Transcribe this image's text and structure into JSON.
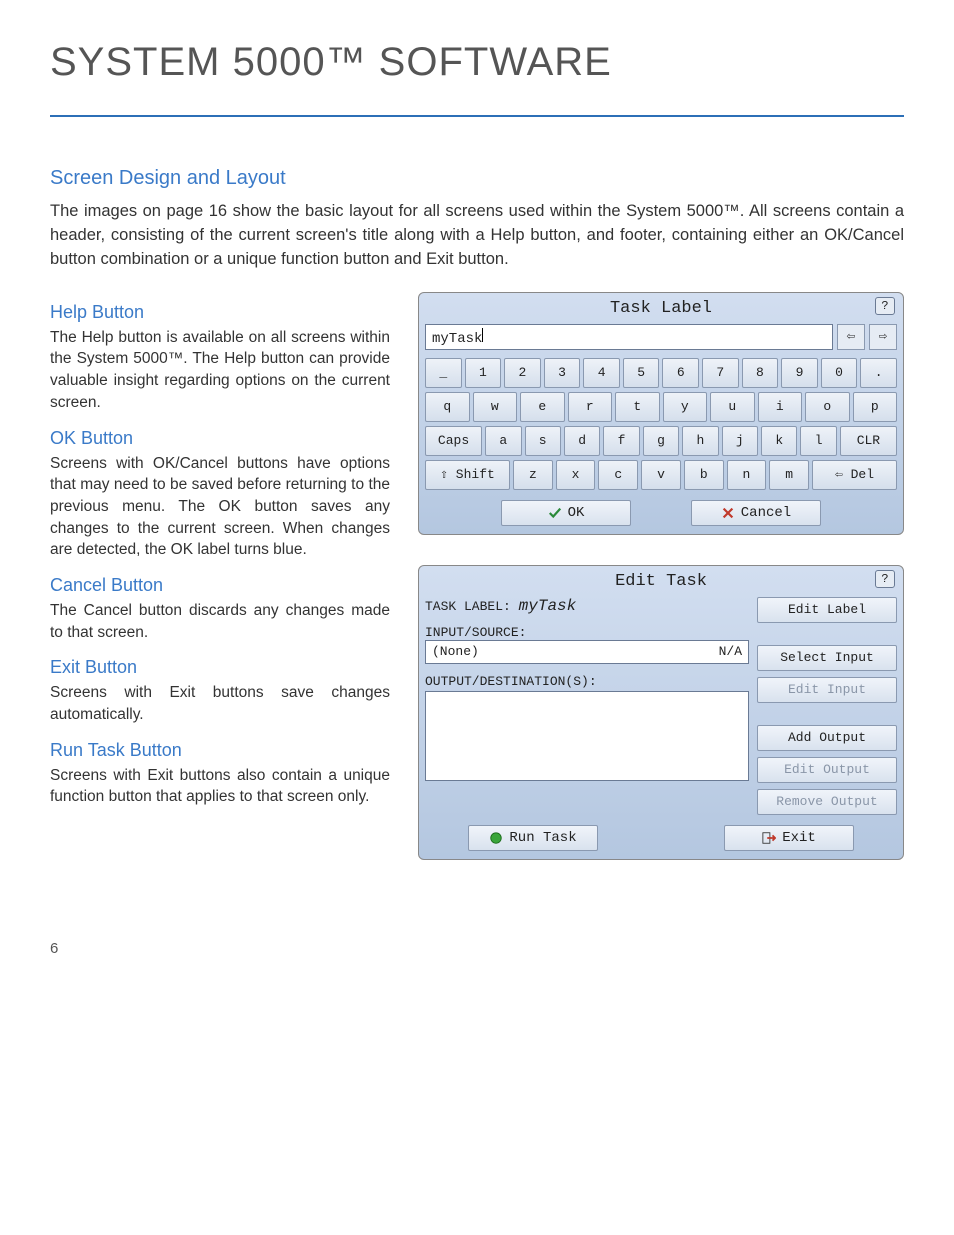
{
  "page": {
    "title": "SYSTEM 5000™ SOFTWARE",
    "page_number": "6"
  },
  "section": {
    "heading": "Screen Design and Layout",
    "intro": "The images on page 16 show the basic layout for all screens used within the System 5000™. All screens contain a header, consisting of the current screen's title along with a Help button, and footer, containing either an OK/Cancel button combination or a unique function button and Exit button."
  },
  "subsections": {
    "help": {
      "heading": "Help Button",
      "body": "The Help button is available on all screens within the System 5000™. The Help button can provide valuable insight regarding options on the current screen."
    },
    "ok": {
      "heading": "OK Button",
      "body": "Screens with OK/Cancel buttons have options that may need to be saved before returning to the previous menu. The OK button saves any changes to the current screen. When changes are detected, the OK label turns blue."
    },
    "cancel": {
      "heading": "Cancel Button",
      "body": "The Cancel button discards any changes made to that screen."
    },
    "exit": {
      "heading": "Exit Button",
      "body": "Screens with Exit buttons save changes automatically."
    },
    "runtask": {
      "heading": "Run Task Button",
      "body": "Screens with Exit buttons also contain a unique function button that applies to that screen only."
    }
  },
  "task_label_panel": {
    "title": "Task Label",
    "input_value": "myTask",
    "keyboard": {
      "row1": [
        "_",
        "1",
        "2",
        "3",
        "4",
        "5",
        "6",
        "7",
        "8",
        "9",
        "0",
        "."
      ],
      "row2": [
        "q",
        "w",
        "e",
        "r",
        "t",
        "y",
        "u",
        "i",
        "o",
        "p"
      ],
      "row3_caps": "Caps",
      "row3": [
        "a",
        "s",
        "d",
        "f",
        "g",
        "h",
        "j",
        "k",
        "l"
      ],
      "row3_clr": "CLR",
      "row4_shift": "Shift",
      "row4": [
        "z",
        "x",
        "c",
        "v",
        "b",
        "n",
        "m"
      ],
      "row4_del": "Del"
    },
    "ok_label": "OK",
    "cancel_label": "Cancel"
  },
  "edit_task_panel": {
    "title": "Edit Task",
    "task_label_caption": "TASK LABEL:",
    "task_label_value": "myTask",
    "input_source_caption": "INPUT/SOURCE:",
    "input_source_value": "(None)",
    "input_source_right": "N/A",
    "output_caption": "OUTPUT/DESTINATION(S):",
    "buttons": {
      "edit_label": "Edit Label",
      "select_input": "Select Input",
      "edit_input": "Edit Input",
      "add_output": "Add Output",
      "edit_output": "Edit Output",
      "remove_output": "Remove Output"
    },
    "run_task": "Run Task",
    "exit": "Exit"
  }
}
